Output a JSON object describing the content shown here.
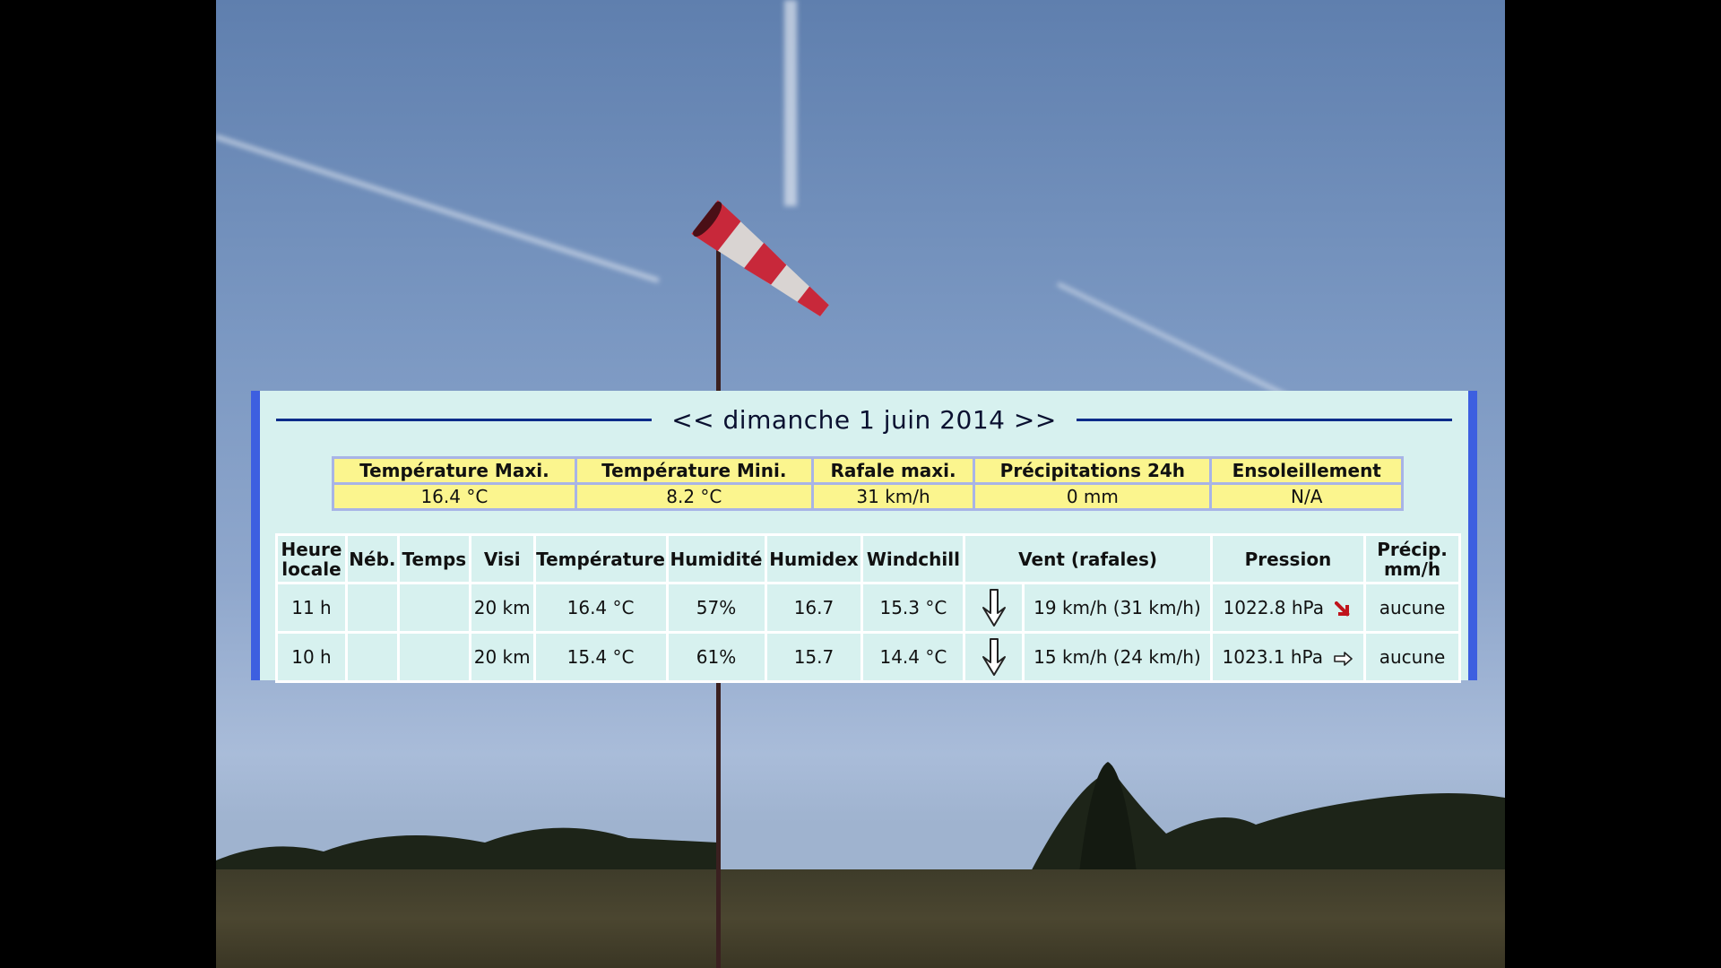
{
  "date_nav": {
    "prev_label": "<<",
    "date": "dimanche 1 juin 2014",
    "next_label": ">>"
  },
  "summary": {
    "headers": [
      "Température Maxi.",
      "Température Mini.",
      "Rafale maxi.",
      "Précipitations 24h",
      "Ensoleillement"
    ],
    "values": [
      "16.4 °C",
      "8.2 °C",
      "31 km/h",
      "0 mm",
      "N/A"
    ]
  },
  "table": {
    "headers": {
      "heure_1": "Heure",
      "heure_2": "locale",
      "neb": "Néb.",
      "temps": "Temps",
      "visi": "Visi",
      "temperature": "Température",
      "humidite": "Humidité",
      "humidex": "Humidex",
      "windchill": "Windchill",
      "vent": "Vent (rafales)",
      "pression": "Pression",
      "precip_1": "Précip.",
      "precip_2": "mm/h"
    },
    "rows": [
      {
        "heure": "11 h",
        "neb": "",
        "temps": "",
        "visi": "20 km",
        "temperature": "16.4 °C",
        "humidite": "57%",
        "humidex": "16.7",
        "windchill": "15.3 °C",
        "wind_direction_icon": "arrow-down-icon",
        "vent": "19 km/h (31 km/h)",
        "pression": "1022.8 hPa",
        "pression_trend_icon": "trend-falling-icon",
        "precip": "aucune"
      },
      {
        "heure": "10 h",
        "neb": "",
        "temps": "",
        "visi": "20 km",
        "temperature": "15.4 °C",
        "humidite": "61%",
        "humidex": "15.7",
        "windchill": "14.4 °C",
        "wind_direction_icon": "arrow-down-icon",
        "vent": "15 km/h (24 km/h)",
        "pression": "1023.1 hPa",
        "pression_trend_icon": "trend-steady-icon",
        "precip": "aucune"
      }
    ]
  },
  "colors": {
    "panel_bg": "#d7f1ef",
    "panel_border": "#3d5fe0",
    "summary_cell": "#fbf58e",
    "trend_falling": "#c0141c"
  }
}
